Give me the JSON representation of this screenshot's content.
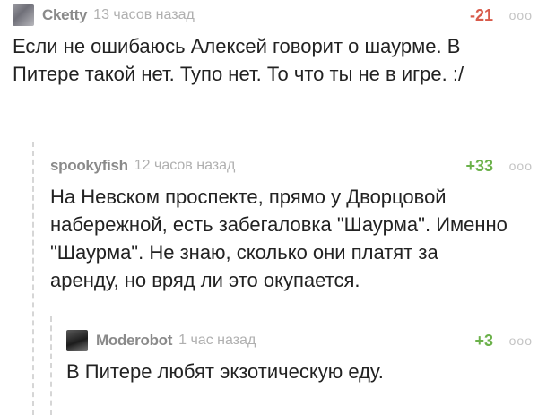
{
  "comments": [
    {
      "username": "Cketty",
      "time": "13 часов назад",
      "rating": "-21",
      "more": "ooo",
      "text": "Если не ошибаюсь Алексей говорит о шаурме. В Питере такой нет. Тупо нет. То что ты не в игре. :/"
    },
    {
      "username": "spookyfish",
      "time": "12 часов назад",
      "rating": "+33",
      "more": "ooo",
      "text": "На Невском проспекте, прямо у Дворцовой набережной, есть забегаловка \"Шаурма\". Именно \"Шаурма\". Не знаю, сколько они платят за аренду, но вряд ли это окупается."
    },
    {
      "username": "Moderobot",
      "time": "1 час назад",
      "rating": "+3",
      "more": "ooo",
      "text": "В Питере любят экзотическую еду."
    }
  ],
  "colors": {
    "negative": "#d85a4a",
    "positive": "#6bb14a",
    "username": "#8a8a8a",
    "time": "#b0b0b0"
  }
}
